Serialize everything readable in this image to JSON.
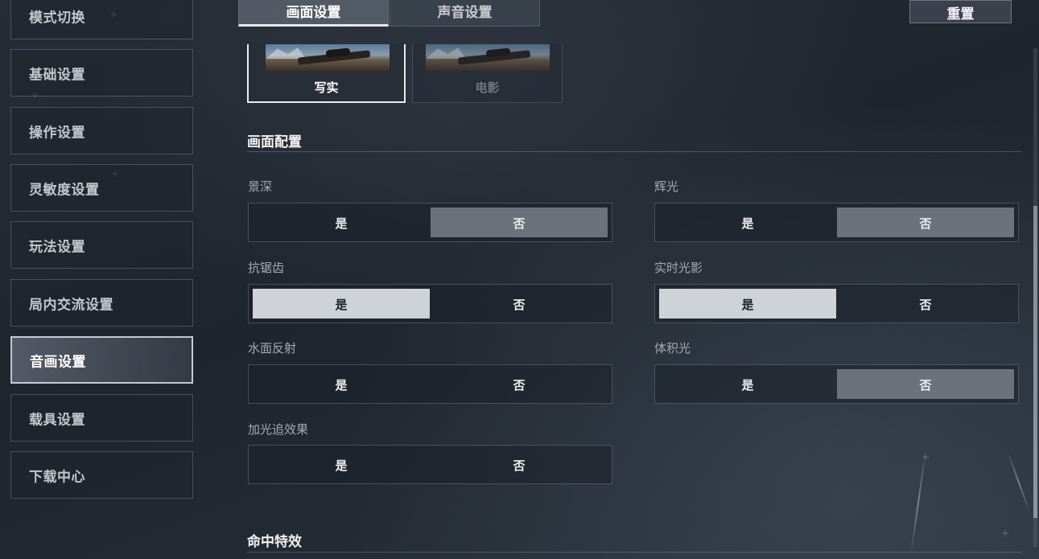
{
  "sidebar": {
    "items": [
      {
        "label": "模式切换"
      },
      {
        "label": "基础设置"
      },
      {
        "label": "操作设置"
      },
      {
        "label": "灵敏度设置"
      },
      {
        "label": "玩法设置"
      },
      {
        "label": "局内交流设置"
      },
      {
        "label": "音画设置"
      },
      {
        "label": "载具设置"
      },
      {
        "label": "下载中心"
      }
    ],
    "active_label": "音画设置"
  },
  "tabs": {
    "video": "画面设置",
    "audio": "声音设置",
    "active": "画面设置"
  },
  "reset_label": "重置",
  "presets": [
    {
      "label": "写实",
      "selected": true
    },
    {
      "label": "电影",
      "selected": false
    }
  ],
  "sections": {
    "graphics_config": "画面配置",
    "hit_effects": "命中特效"
  },
  "options": {
    "depth_of_field": {
      "label": "景深",
      "yes": "是",
      "no": "否",
      "value": "否"
    },
    "bloom": {
      "label": "辉光",
      "yes": "是",
      "no": "否",
      "value": "否"
    },
    "anti_aliasing": {
      "label": "抗锯齿",
      "yes": "是",
      "no": "否",
      "value": "是"
    },
    "realtime_shadows": {
      "label": "实时光影",
      "yes": "是",
      "no": "否",
      "value": "是"
    },
    "water_reflection": {
      "label": "水面反射",
      "yes": "是",
      "no": "否",
      "value": ""
    },
    "volumetric_light": {
      "label": "体积光",
      "yes": "是",
      "no": "否",
      "value": "否"
    },
    "ray_tracing": {
      "label": "加光追效果",
      "yes": "是",
      "no": "否",
      "value": ""
    }
  },
  "colors": {
    "selected_yes": "#cfd2d8",
    "selected_no": "#6b727c",
    "active_border": "#e8ebef"
  }
}
